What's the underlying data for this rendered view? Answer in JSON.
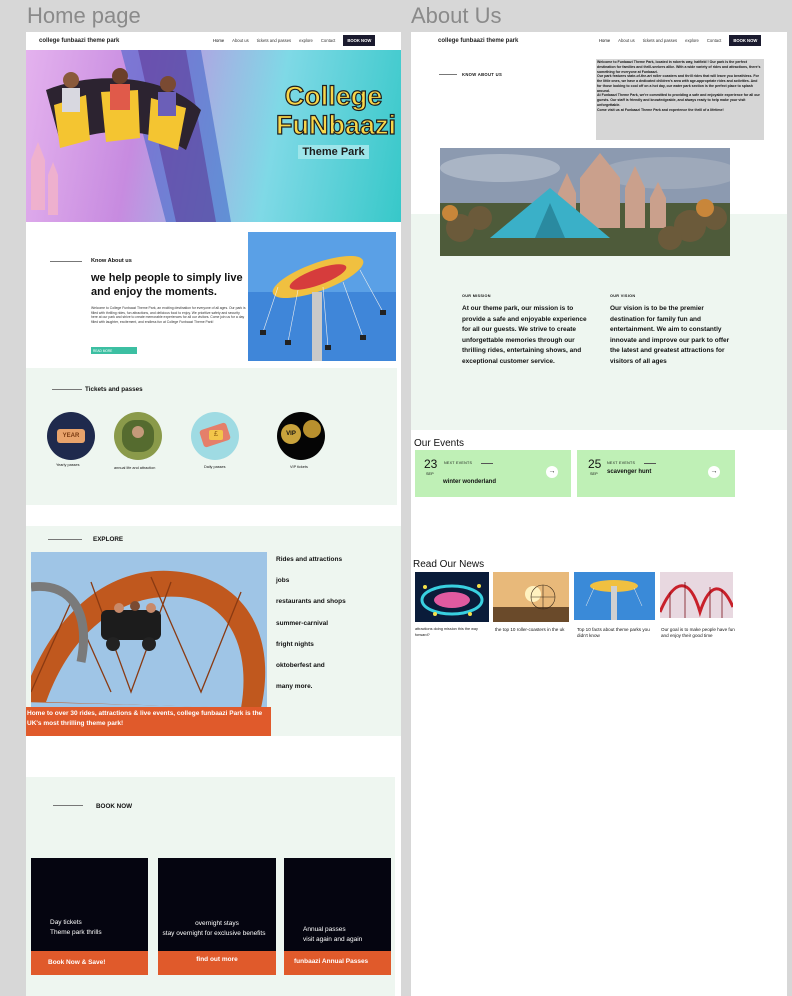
{
  "frames": {
    "home_label": "Home page",
    "about_label": "About Us"
  },
  "nav": {
    "brand": "college funbaazi theme park",
    "links": [
      "Home",
      "About us",
      "tickets and passes",
      "explore",
      "Contact"
    ],
    "cta": "BOOK NOW"
  },
  "hero": {
    "logo_line1": "College",
    "logo_line2": "FuNbaazi",
    "logo_line3": "Theme Park"
  },
  "about_home": {
    "kicker": "Know About us",
    "heading": "we help people to simply live and enjoy the moments.",
    "body": "Welcome to College Funbaazi Theme Park, an exciting destination for everyone of all ages. Our park is filled with thrilling rides, fun attractions, and delicious food to enjoy. We prioritize safety and security here at our park and strive to create memorable experiences for all our visitors. Come join us for a day filled with laughter, excitement, and endless fun at College Funbaazi Theme Park!",
    "button": "READ MORE"
  },
  "tickets": {
    "title": "Tickets and passes",
    "items": [
      {
        "label": "Yearly passes",
        "badge": "YEAR"
      },
      {
        "label": "annual life and attraction",
        "badge": ""
      },
      {
        "label": "Daily passes",
        "badge": "£"
      },
      {
        "label": "VIP tickets",
        "badge": "VIP"
      }
    ]
  },
  "explore": {
    "title": "EXPLORE",
    "items": [
      "Rides and  attractions",
      "jobs",
      "restaurants and shops",
      "summer-carnival",
      "fright nights",
      "oktoberfest  and",
      "many more."
    ],
    "banner": "Home to over 30 rides, attractions & live events, college funbaazi Park is the UK's most thrilling theme park!"
  },
  "book": {
    "title": "BOOK NOW",
    "cards": [
      {
        "line1": "Day tickets",
        "line2": "Theme park thrills",
        "cta": "Book Now & Save!"
      },
      {
        "line1": "overnight stays",
        "line2": "stay overnight for exclusive benefits",
        "cta": "find out more"
      },
      {
        "line1": "Annual passes",
        "line2": "visit again and again",
        "cta": "funbaazi Annual Passes"
      }
    ]
  },
  "about_page": {
    "kicker": "KNOW ABOUT US",
    "welcome": "Welcome to Funbaazi Theme Park, located in roberts way, hatfield ! Our park is the perfect destination for families and thrill-seekers alike. With a wide variety of rides and attractions, there's something for everyone at Funbaazi.\nOur park features state-of-the-art roller coasters and thrill rides that will leave you breathless. For the little ones, we have a dedicated children's area with age-appropriate rides and activities. And for those looking to cool off on a hot day, our water park section is the perfect place to splash around.\nAt Funbaazi Theme Park, we're committed to providing a safe and enjoyable experience for all our guests. Our staff is friendly and knowledgeable, and always ready to help make your visit unforgettable.\nCome visit us at Funbaazi Theme Park and experience the thrill of a lifetime!",
    "mission_label": "OUR MISSION",
    "mission": "At our theme park, our mission is to provide a safe and enjoyable experience for all our guests. We strive to create unforgettable memories through our thrilling rides, entertaining shows, and exceptional customer service.",
    "vision_label": "OUR VISION",
    "vision": "Our vision is to be the premier destination for family fun and entertainment. We aim to constantly innovate and improve our park to offer the latest and greatest attractions for visitors of all ages"
  },
  "events": {
    "title": "Our Events",
    "items": [
      {
        "day": "23",
        "month": "SEP",
        "tag": "NEXT EVENTS",
        "name": "winter wonderland"
      },
      {
        "day": "25",
        "month": "SEP",
        "tag": "NEXT EVENTS",
        "name": "scavenger hunt"
      }
    ]
  },
  "news": {
    "title": "Read Our News",
    "items": [
      {
        "title": "attractions doing mission this the way forward?"
      },
      {
        "title": "the top 10 roller-coasters in the uk"
      },
      {
        "title": "Top 10 facts about theme parks you didn't know"
      },
      {
        "title": "Our goal is to make people have fun and enjoy their good time"
      }
    ]
  },
  "colors": {
    "accent": "#e05a2b",
    "mint": "#eef6f0",
    "event": "#bff0b6",
    "teal": "#3cbfa2"
  }
}
